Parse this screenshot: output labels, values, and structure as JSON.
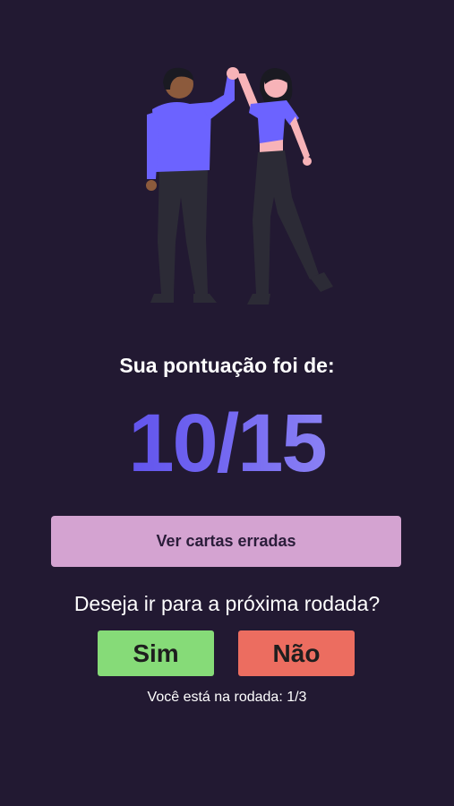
{
  "result": {
    "score_label": "Sua pontuação foi de:",
    "score_value": "10/15",
    "wrong_cards_label": "Ver cartas erradas",
    "next_round_question": "Deseja ir para a próxima rodada?",
    "yes_label": "Sim",
    "no_label": "Não",
    "round_info": "Você está na rodada: 1/3"
  },
  "colors": {
    "background": "#221932",
    "accent_purple": "#6c63ff",
    "wrong_cards_button": "#d4a3d1",
    "yes_button": "#86db78",
    "no_button": "#ec6d60"
  },
  "illustration": "high-five-people-illustration"
}
